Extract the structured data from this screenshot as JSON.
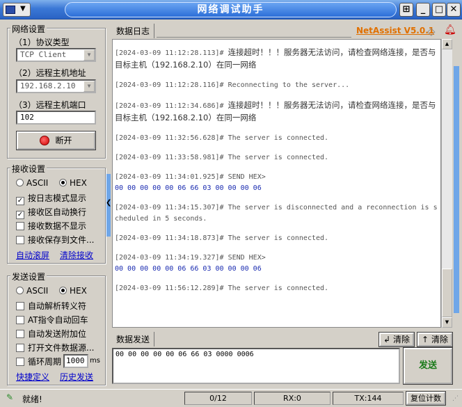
{
  "window": {
    "title": "网络调试助手"
  },
  "brand": {
    "name": "NetAssist V5.0.1",
    "color": "#e07000"
  },
  "net_settings": {
    "title": "网络设置",
    "protocol_label": "（1）协议类型",
    "protocol_value": "TCP Client",
    "host_label": "（2）远程主机地址",
    "host_value": "192.168.2.10",
    "port_label": "（3）远程主机端口",
    "port_value": "102",
    "connect_button": "断开"
  },
  "recv_settings": {
    "title": "接收设置",
    "ascii_label": "ASCII",
    "hex_label": "HEX",
    "selected": "HEX",
    "options": [
      {
        "label": "按日志模式显示",
        "checked": true
      },
      {
        "label": "接收区自动换行",
        "checked": true
      },
      {
        "label": "接收数据不显示",
        "checked": false
      },
      {
        "label": "接收保存到文件...",
        "checked": false
      }
    ],
    "auto_scroll": "自动滚屏",
    "clear_recv": "清除接收"
  },
  "send_settings": {
    "title": "发送设置",
    "ascii_label": "ASCII",
    "hex_label": "HEX",
    "selected": "HEX",
    "options": [
      {
        "label": "自动解析转义符",
        "checked": false
      },
      {
        "label": "AT指令自动回车",
        "checked": false
      },
      {
        "label": "自动发送附加位",
        "checked": false
      },
      {
        "label": "打开文件数据源...",
        "checked": false
      }
    ],
    "loop_label": "循环周期",
    "loop_value": "1000",
    "loop_unit": "ms",
    "quick_define": "快捷定义",
    "history_send": "历史发送"
  },
  "log_panel": {
    "tab_label": "数据日志",
    "entries": [
      {
        "ts": "[2024-03-09 11:12:28.113]#",
        "text": "连接超时！！！服务器无法访问，请检查网络连接，是否与目标主机（192.168.2.10）在同一网络",
        "cn": true
      },
      {
        "ts": "[2024-03-09 11:12:28.116]#",
        "text": "Reconnecting to the server...",
        "cn": false
      },
      {
        "ts": "[2024-03-09 11:12:34.686]#",
        "text": "连接超时！！！服务器无法访问，请检查网络连接，是否与目标主机（192.168.2.10）在同一网络",
        "cn": true
      },
      {
        "ts": "[2024-03-09 11:32:56.628]#",
        "text": "The server is connected.",
        "cn": false
      },
      {
        "ts": "[2024-03-09 11:33:58.981]#",
        "text": "The server is connected.",
        "cn": false
      },
      {
        "ts": "[2024-03-09 11:34:01.925]#",
        "text": "SEND HEX>",
        "cn": false,
        "hex": "00 00 00 00 00 06 66 03 00 00 00 06"
      },
      {
        "ts": "[2024-03-09 11:34:15.307]#",
        "text": "The server is disconnected and a reconnection is scheduled in 5 seconds.",
        "cn": false
      },
      {
        "ts": "[2024-03-09 11:34:18.873]#",
        "text": "The server is connected.",
        "cn": false
      },
      {
        "ts": "[2024-03-09 11:34:19.327]#",
        "text": "SEND HEX>",
        "cn": false,
        "hex": "00 00 00 00 00 06 66 03 00 00 00 06"
      },
      {
        "ts": "[2024-03-09 11:56:12.289]#",
        "text": "The server is connected.",
        "cn": false
      }
    ]
  },
  "send_panel": {
    "tab_label": "数据发送",
    "clear1": "清除",
    "clear2": "清除",
    "input_value": "00 00 00 00 00 06 66 03 0000 0006",
    "send_button": "发送"
  },
  "status": {
    "ready": "就绪!",
    "count": "0/12",
    "rx": "RX:0",
    "tx": "TX:144",
    "reset": "复位计数"
  }
}
